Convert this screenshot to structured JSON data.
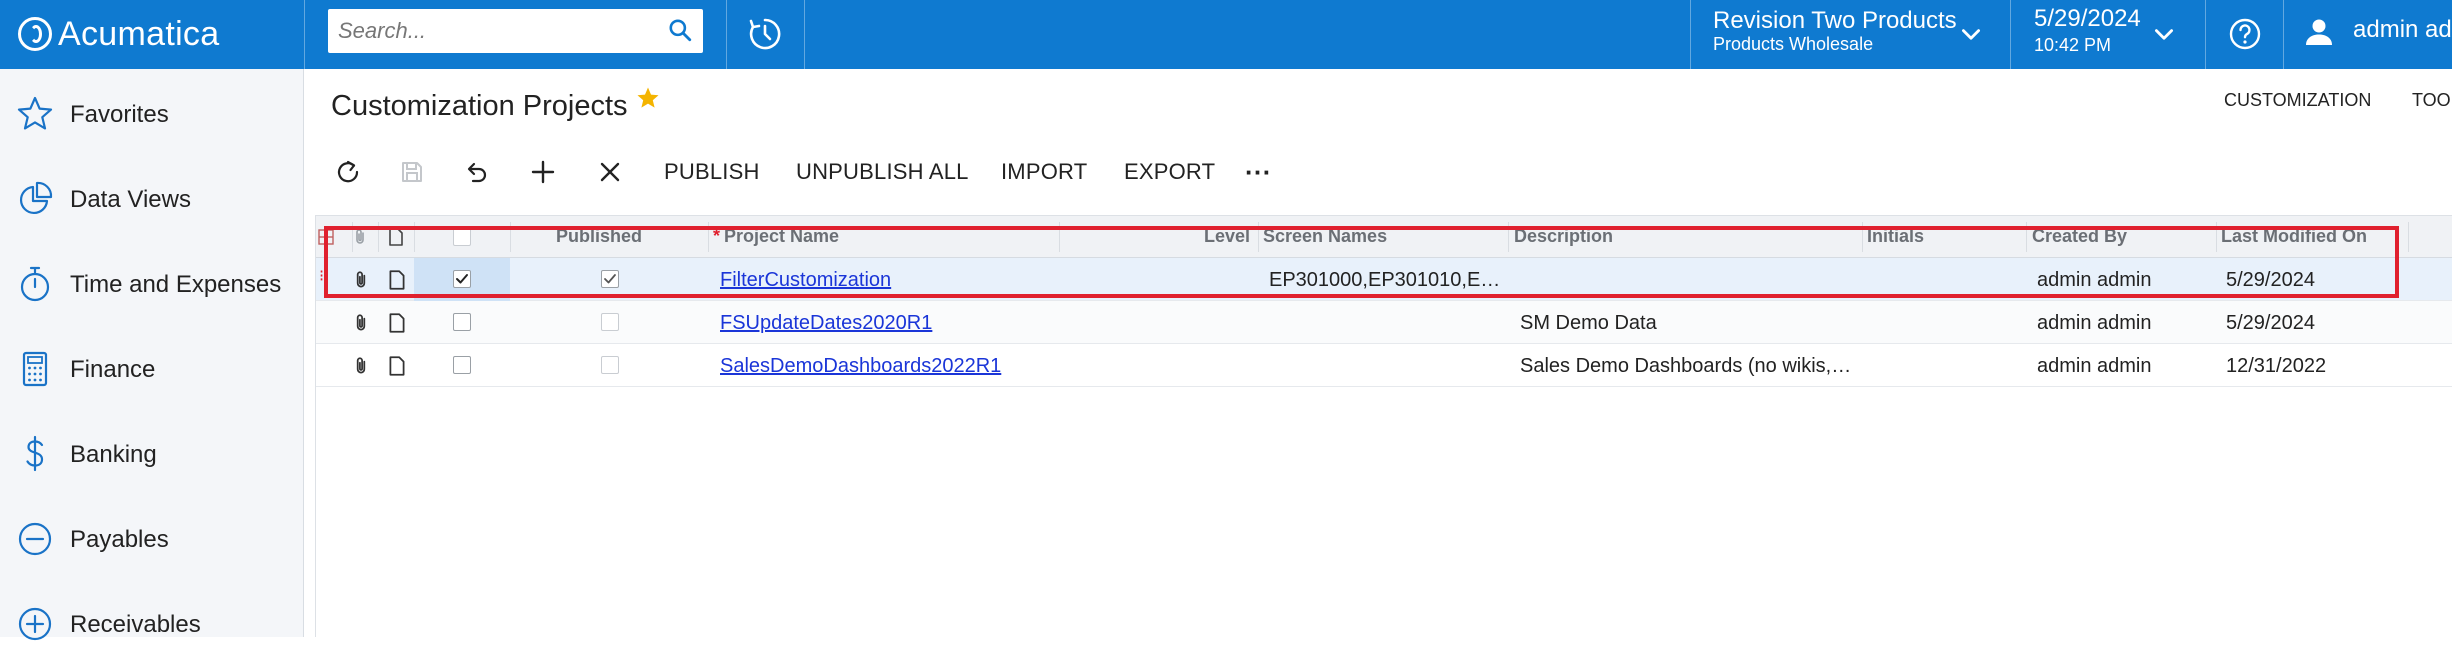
{
  "topbar": {
    "logo_text": "Acumatica",
    "search_placeholder": "Search...",
    "company": {
      "name": "Revision Two Products",
      "branch": "Products Wholesale"
    },
    "date": "5/29/2024",
    "time": "10:42 PM",
    "user_name": "admin admin"
  },
  "sidebar": {
    "items": [
      {
        "label": "Favorites",
        "icon": "star-icon"
      },
      {
        "label": "Data Views",
        "icon": "pie-chart-icon"
      },
      {
        "label": "Time and Expenses",
        "icon": "stopwatch-icon"
      },
      {
        "label": "Finance",
        "icon": "calculator-icon"
      },
      {
        "label": "Banking",
        "icon": "dollar-icon"
      },
      {
        "label": "Payables",
        "icon": "minus-circle-icon"
      },
      {
        "label": "Receivables",
        "icon": "plus-circle-icon"
      }
    ]
  },
  "page": {
    "title": "Customization Projects",
    "nav_customization": "CUSTOMIZATION",
    "nav_tools": "TOOLS"
  },
  "toolbar": {
    "publish": "PUBLISH",
    "unpublish_all": "UNPUBLISH ALL",
    "import": "IMPORT",
    "export": "EXPORT",
    "more": "···"
  },
  "grid": {
    "columns": {
      "published": "Published",
      "required_mark": "*",
      "project_name": "Project Name",
      "level": "Level",
      "screen_names": "Screen Names",
      "description": "Description",
      "initials": "Initials",
      "created_by": "Created By",
      "last_modified_on": "Last Modified On"
    },
    "rows": [
      {
        "selected_checked": true,
        "published": true,
        "project_name": "FilterCustomization",
        "level": "",
        "screen_names": "EP301000,EP301010,E…",
        "description": "",
        "initials": "",
        "created_by": "admin admin",
        "last_modified_on": "5/29/2024"
      },
      {
        "selected_checked": false,
        "published": false,
        "project_name": "FSUpdateDates2020R1",
        "level": "",
        "screen_names": "",
        "description": "SM Demo Data",
        "initials": "",
        "created_by": "admin admin",
        "last_modified_on": "5/29/2024"
      },
      {
        "selected_checked": false,
        "published": false,
        "project_name": "SalesDemoDashboards2022R1",
        "level": "",
        "screen_names": "",
        "description": "Sales Demo Dashboards (no wikis,…",
        "initials": "",
        "created_by": "admin admin",
        "last_modified_on": "12/31/2022"
      }
    ]
  },
  "colors": {
    "topbar": "#0f7ad0",
    "highlight": "#e0202e",
    "link": "#1a35d8",
    "star": "#f4b400"
  }
}
